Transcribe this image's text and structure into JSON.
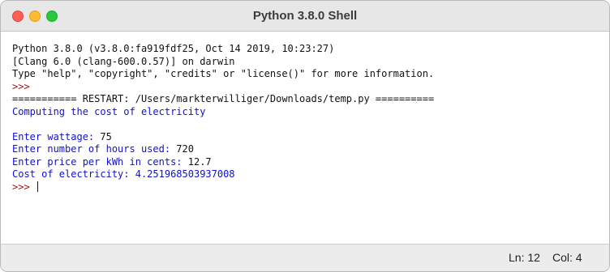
{
  "window": {
    "title": "Python 3.8.0 Shell"
  },
  "shell": {
    "lines": [
      {
        "text": "Python 3.8.0 (v3.8.0:fa919fdf25, Oct 14 2019, 10:23:27)",
        "style": "black"
      },
      {
        "text": "[Clang 6.0 (clang-600.0.57)] on darwin",
        "style": "black"
      },
      {
        "text": "Type \"help\", \"copyright\", \"credits\" or \"license()\" for more information.",
        "style": "black"
      },
      {
        "text": ">>>",
        "style": "prompt"
      },
      {
        "text": "=========== RESTART: /Users/markterwilliger/Downloads/temp.py ==========",
        "style": "black"
      },
      {
        "text": "Computing the cost of electricity",
        "style": "blue"
      },
      {
        "text": "",
        "style": "blue"
      },
      {
        "text": "Enter wattage: ",
        "input": "75",
        "style": "blue"
      },
      {
        "text": "Enter number of hours used: ",
        "input": "720",
        "style": "blue"
      },
      {
        "text": "Enter price per kWh in cents: ",
        "input": "12.7",
        "style": "blue"
      },
      {
        "text": "Cost of electricity: 4.251968503937008",
        "style": "blue"
      }
    ],
    "prompt": ">>> "
  },
  "status": {
    "ln": "Ln: 12",
    "col": "Col: 4"
  }
}
